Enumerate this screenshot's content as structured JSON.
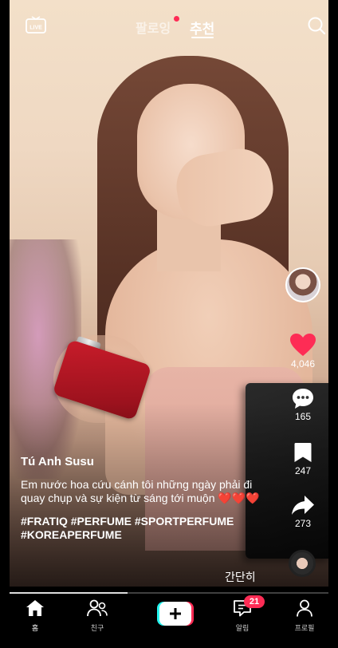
{
  "topbar": {
    "live_label": "LIVE",
    "tab_following": "팔로잉",
    "tab_for_you": "추천"
  },
  "video": {
    "progress": 0.37
  },
  "creator": {
    "username": "Tú Anh Susu"
  },
  "caption": {
    "text": "Em nước hoa cứu cánh tôi những ngày phải đi quay chụp và sự kiện từ sáng tới muộn ❤️❤️❤️",
    "hashtags": "#FRATIQ #PERFUME #SPORTPERFUME #KOREAPERFUME",
    "collapse_label": "간단히"
  },
  "actions": {
    "likes": "4,046",
    "comments": "165",
    "saves": "247",
    "shares": "273"
  },
  "bottom_nav": {
    "home": "홈",
    "friends": "친구",
    "inbox": "알림",
    "inbox_badge": "21",
    "profile": "프로필"
  },
  "colors": {
    "accent_red": "#fe2c55",
    "like_red": "#fe2c55",
    "create_cyan": "#25f4ee"
  }
}
